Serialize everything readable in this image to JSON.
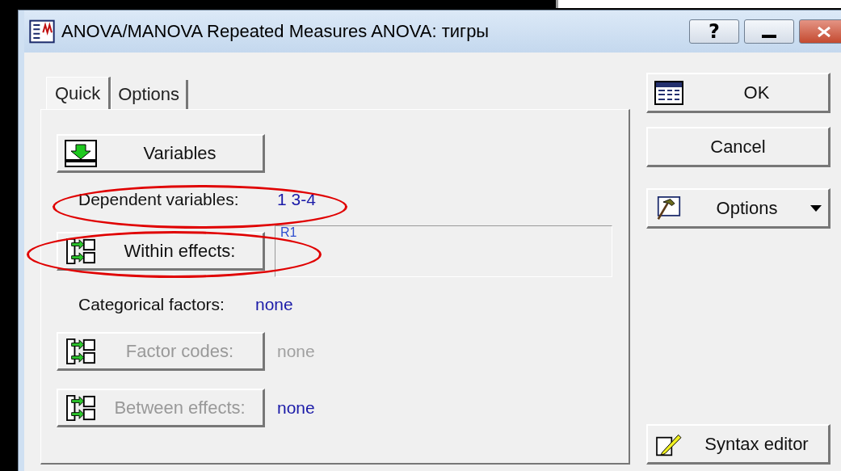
{
  "window": {
    "title": "ANOVA/MANOVA Repeated Measures ANOVA: тигры",
    "help_button": "?"
  },
  "tabs": [
    {
      "label": "Quick",
      "selected": true
    },
    {
      "label": "Options",
      "selected": false
    }
  ],
  "rows": [
    {
      "kind": "variables",
      "label": "Variables",
      "disabled": false,
      "circled": false
    },
    {
      "kind": "info",
      "label": "Dependent variables:",
      "value": "1 3-4",
      "disabled": false,
      "circled": true
    },
    {
      "kind": "effects_box",
      "label": "Within effects:",
      "value": "R1",
      "disabled": false,
      "circled": true
    },
    {
      "kind": "info",
      "label": "Categorical factors:",
      "value": "none",
      "disabled": false,
      "circled": false
    },
    {
      "kind": "effects_value",
      "label": "Factor codes:",
      "value": "none",
      "value_dim": true,
      "disabled": true,
      "circled": false
    },
    {
      "kind": "effects_value",
      "label": "Between effects:",
      "value": "none",
      "value_dim": false,
      "disabled": true,
      "circled": false
    }
  ],
  "side_buttons": [
    {
      "kind": "ok",
      "label": "OK"
    },
    {
      "kind": "plain",
      "label": "Cancel"
    },
    {
      "kind": "options",
      "label": "Options"
    },
    {
      "kind": "syntax",
      "label": "Syntax editor"
    }
  ]
}
